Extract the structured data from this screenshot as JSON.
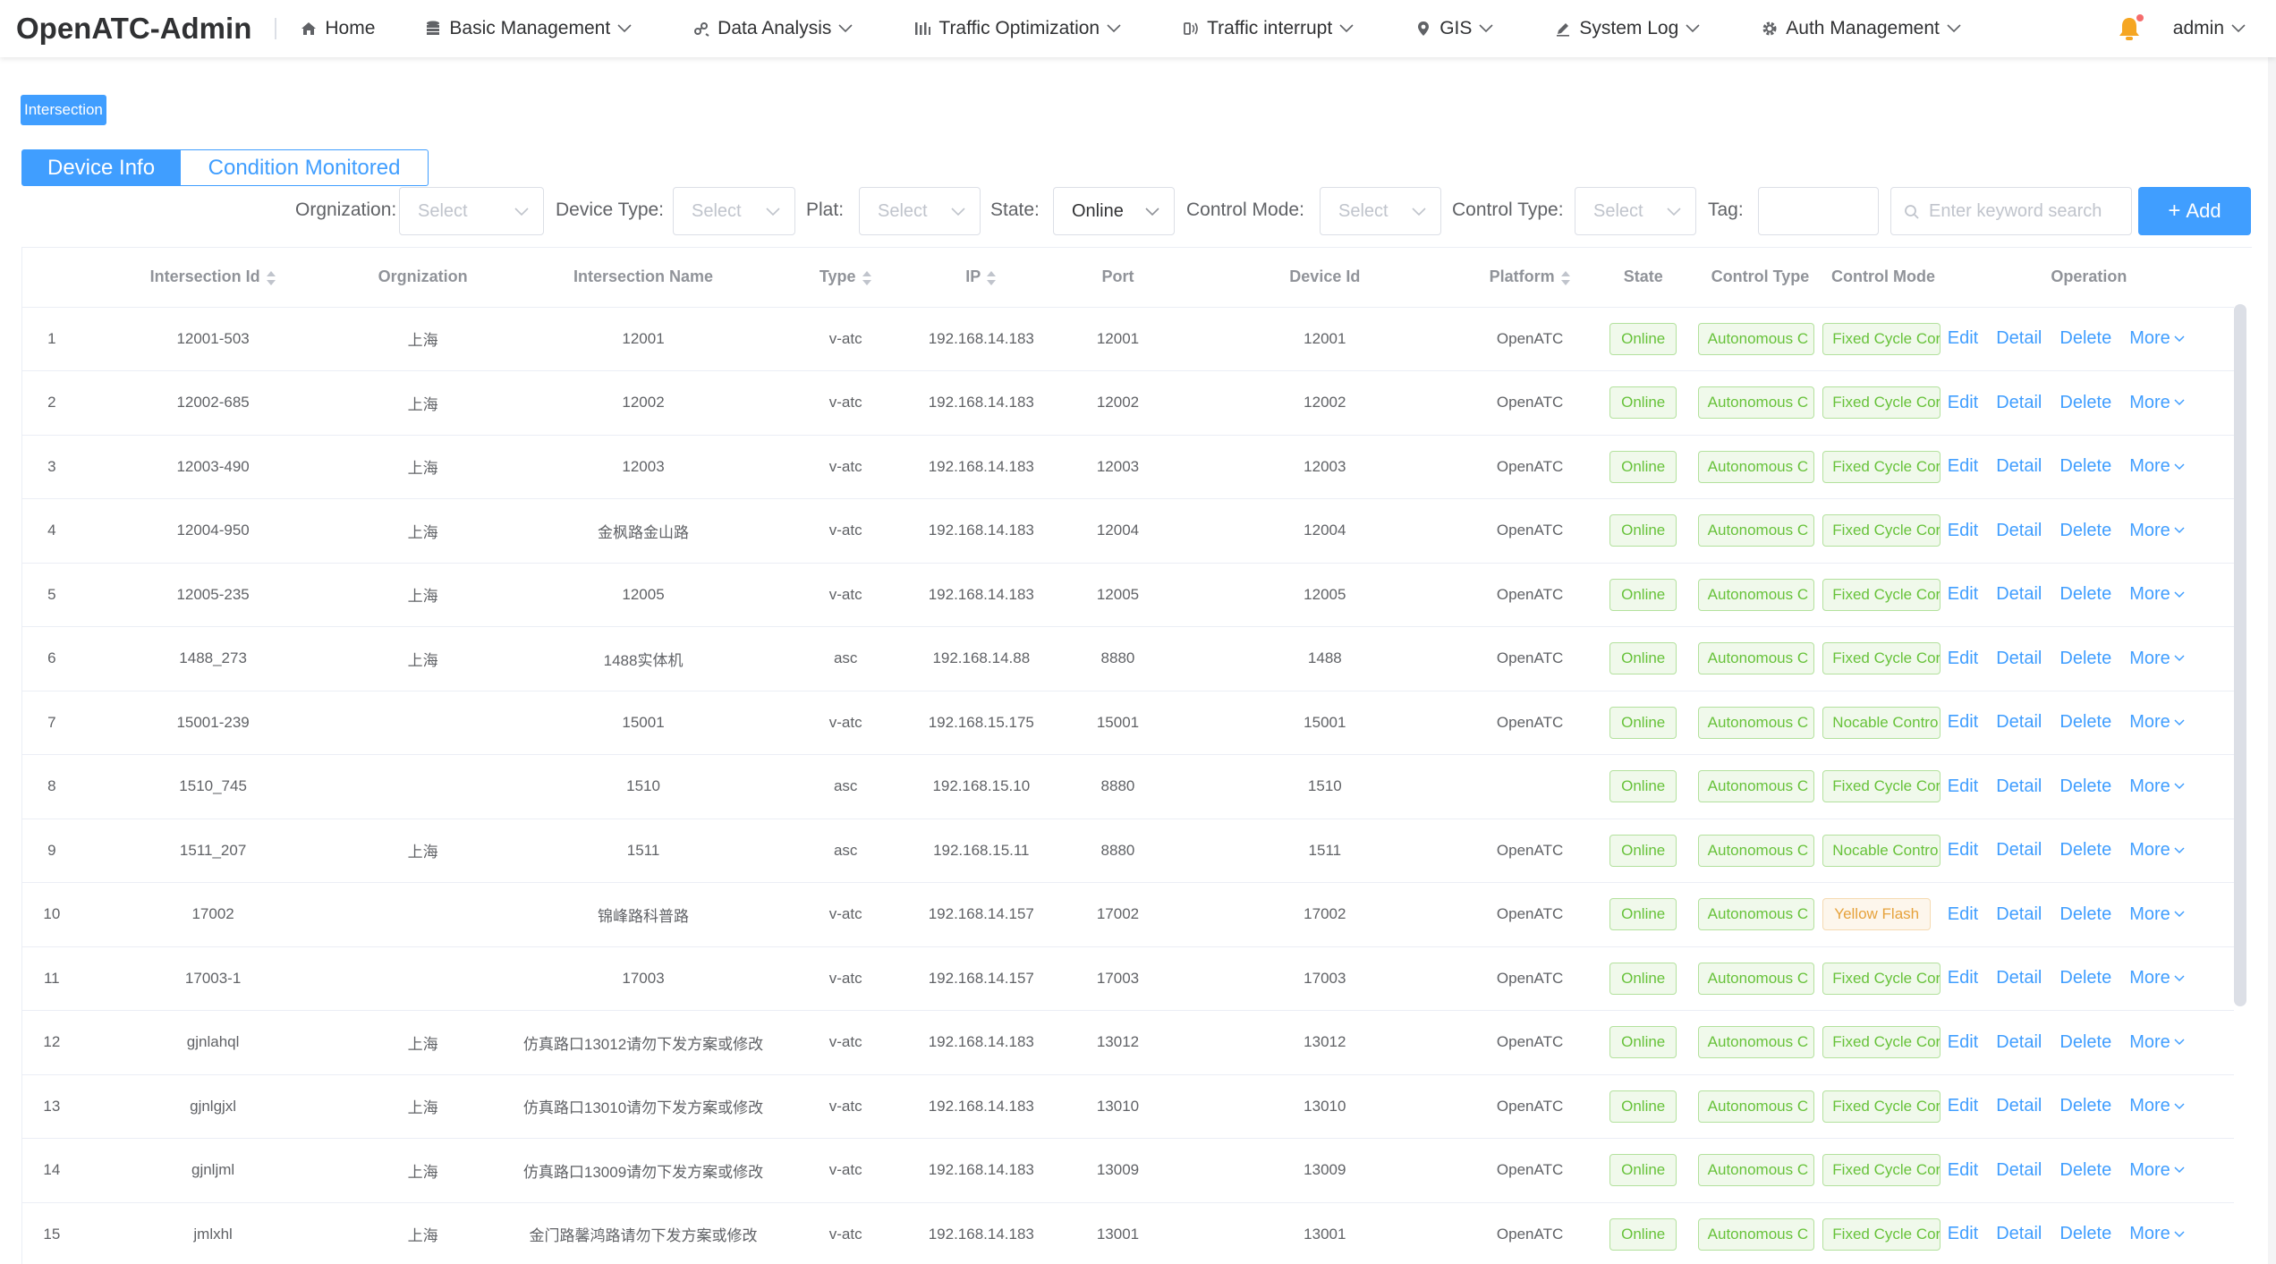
{
  "app": {
    "title": "OpenATC-Admin"
  },
  "nav": [
    {
      "label": "Home",
      "icon": "home-icon",
      "dropdown": false
    },
    {
      "label": "Basic Management",
      "icon": "database-icon",
      "dropdown": true
    },
    {
      "label": "Data Analysis",
      "icon": "analysis-icon",
      "dropdown": true
    },
    {
      "label": "Traffic Optimization",
      "icon": "bars-icon",
      "dropdown": true
    },
    {
      "label": "Traffic interrupt",
      "icon": "signal-icon",
      "dropdown": true
    },
    {
      "label": "GIS",
      "icon": "map-pin-icon",
      "dropdown": true
    },
    {
      "label": "System Log",
      "icon": "pen-icon",
      "dropdown": true
    },
    {
      "label": "Auth Management",
      "icon": "gear-icon",
      "dropdown": true
    }
  ],
  "user": {
    "name": "admin"
  },
  "page_tag": "Intersection",
  "tabs": [
    {
      "label": "Device Info",
      "active": true
    },
    {
      "label": "Condition Monitored",
      "active": false
    }
  ],
  "filters": {
    "organization": {
      "label": "Orgnization",
      "placeholder": "Select"
    },
    "device_type": {
      "label": "Device Type",
      "placeholder": "Select"
    },
    "plat": {
      "label": "Plat",
      "placeholder": "Select"
    },
    "state": {
      "label": "State",
      "value": "Online"
    },
    "control_mode": {
      "label": "Control Mode",
      "placeholder": "Select"
    },
    "control_type": {
      "label": "Control Type",
      "placeholder": "Select"
    },
    "tag": {
      "label": "Tag",
      "value": ""
    },
    "search": {
      "placeholder": "Enter keyword search"
    },
    "add_label": "Add"
  },
  "table": {
    "headers": {
      "intersection_id": "Intersection Id",
      "organization": "Orgnization",
      "intersection_name": "Intersection Name",
      "type": "Type",
      "ip": "IP",
      "port": "Port",
      "device_id": "Device Id",
      "platform": "Platform",
      "state": "State",
      "control_type": "Control Type",
      "control_mode": "Control Mode",
      "operation": "Operation"
    },
    "actions": {
      "edit": "Edit",
      "detail": "Detail",
      "delete": "Delete",
      "more": "More"
    },
    "rows": [
      {
        "no": "1",
        "id": "12001-503",
        "org": "上海",
        "name": "12001",
        "type": "v-atc",
        "ip": "192.168.14.183",
        "port": "12001",
        "device_id": "12001",
        "platform": "OpenATC",
        "state": "Online",
        "control_type": "Autonomous C",
        "control_mode": "Fixed Cycle Cor",
        "mode_status": "normal"
      },
      {
        "no": "2",
        "id": "12002-685",
        "org": "上海",
        "name": "12002",
        "type": "v-atc",
        "ip": "192.168.14.183",
        "port": "12002",
        "device_id": "12002",
        "platform": "OpenATC",
        "state": "Online",
        "control_type": "Autonomous C",
        "control_mode": "Fixed Cycle Cor",
        "mode_status": "normal"
      },
      {
        "no": "3",
        "id": "12003-490",
        "org": "上海",
        "name": "12003",
        "type": "v-atc",
        "ip": "192.168.14.183",
        "port": "12003",
        "device_id": "12003",
        "platform": "OpenATC",
        "state": "Online",
        "control_type": "Autonomous C",
        "control_mode": "Fixed Cycle Cor",
        "mode_status": "normal"
      },
      {
        "no": "4",
        "id": "12004-950",
        "org": "上海",
        "name": "金枫路金山路",
        "type": "v-atc",
        "ip": "192.168.14.183",
        "port": "12004",
        "device_id": "12004",
        "platform": "OpenATC",
        "state": "Online",
        "control_type": "Autonomous C",
        "control_mode": "Fixed Cycle Cor",
        "mode_status": "normal"
      },
      {
        "no": "5",
        "id": "12005-235",
        "org": "上海",
        "name": "12005",
        "type": "v-atc",
        "ip": "192.168.14.183",
        "port": "12005",
        "device_id": "12005",
        "platform": "OpenATC",
        "state": "Online",
        "control_type": "Autonomous C",
        "control_mode": "Fixed Cycle Cor",
        "mode_status": "normal"
      },
      {
        "no": "6",
        "id": "1488_273",
        "org": "上海",
        "name": "1488实体机",
        "type": "asc",
        "ip": "192.168.14.88",
        "port": "8880",
        "device_id": "1488",
        "platform": "OpenATC",
        "state": "Online",
        "control_type": "Autonomous C",
        "control_mode": "Fixed Cycle Cor",
        "mode_status": "normal"
      },
      {
        "no": "7",
        "id": "15001-239",
        "org": "",
        "name": "15001",
        "type": "v-atc",
        "ip": "192.168.15.175",
        "port": "15001",
        "device_id": "15001",
        "platform": "OpenATC",
        "state": "Online",
        "control_type": "Autonomous C",
        "control_mode": "Nocable Contro",
        "mode_status": "normal"
      },
      {
        "no": "8",
        "id": "1510_745",
        "org": "",
        "name": "1510",
        "type": "asc",
        "ip": "192.168.15.10",
        "port": "8880",
        "device_id": "1510",
        "platform": "",
        "state": "Online",
        "control_type": "Autonomous C",
        "control_mode": "Fixed Cycle Cor",
        "mode_status": "normal"
      },
      {
        "no": "9",
        "id": "1511_207",
        "org": "上海",
        "name": "1511",
        "type": "asc",
        "ip": "192.168.15.11",
        "port": "8880",
        "device_id": "1511",
        "platform": "OpenATC",
        "state": "Online",
        "control_type": "Autonomous C",
        "control_mode": "Nocable Contro",
        "mode_status": "normal"
      },
      {
        "no": "10",
        "id": "17002",
        "org": "",
        "name": "锦峰路科普路",
        "type": "v-atc",
        "ip": "192.168.14.157",
        "port": "17002",
        "device_id": "17002",
        "platform": "OpenATC",
        "state": "Online",
        "control_type": "Autonomous C",
        "control_mode": "Yellow Flash",
        "mode_status": "warn"
      },
      {
        "no": "11",
        "id": "17003-1",
        "org": "",
        "name": "17003",
        "type": "v-atc",
        "ip": "192.168.14.157",
        "port": "17003",
        "device_id": "17003",
        "platform": "OpenATC",
        "state": "Online",
        "control_type": "Autonomous C",
        "control_mode": "Fixed Cycle Cor",
        "mode_status": "normal"
      },
      {
        "no": "12",
        "id": "gjnlahql",
        "org": "上海",
        "name": "仿真路口13012请勿下发方案或修改",
        "type": "v-atc",
        "ip": "192.168.14.183",
        "port": "13012",
        "device_id": "13012",
        "platform": "OpenATC",
        "state": "Online",
        "control_type": "Autonomous C",
        "control_mode": "Fixed Cycle Cor",
        "mode_status": "normal"
      },
      {
        "no": "13",
        "id": "gjnlgjxl",
        "org": "上海",
        "name": "仿真路口13010请勿下发方案或修改",
        "type": "v-atc",
        "ip": "192.168.14.183",
        "port": "13010",
        "device_id": "13010",
        "platform": "OpenATC",
        "state": "Online",
        "control_type": "Autonomous C",
        "control_mode": "Fixed Cycle Cor",
        "mode_status": "normal"
      },
      {
        "no": "14",
        "id": "gjnljml",
        "org": "上海",
        "name": "仿真路口13009请勿下发方案或修改",
        "type": "v-atc",
        "ip": "192.168.14.183",
        "port": "13009",
        "device_id": "13009",
        "platform": "OpenATC",
        "state": "Online",
        "control_type": "Autonomous C",
        "control_mode": "Fixed Cycle Cor",
        "mode_status": "normal"
      },
      {
        "no": "15",
        "id": "jmlxhl",
        "org": "上海",
        "name": "金门路馨鸿路请勿下发方案或修改",
        "type": "v-atc",
        "ip": "192.168.14.183",
        "port": "13001",
        "device_id": "13001",
        "platform": "OpenATC",
        "state": "Online",
        "control_type": "Autonomous C",
        "control_mode": "Fixed Cycle Cor",
        "mode_status": "normal"
      }
    ]
  },
  "colors": {
    "primary": "#409eff",
    "success": "#67c23a",
    "warning": "#e6a23c",
    "notify": "#f5a623"
  }
}
